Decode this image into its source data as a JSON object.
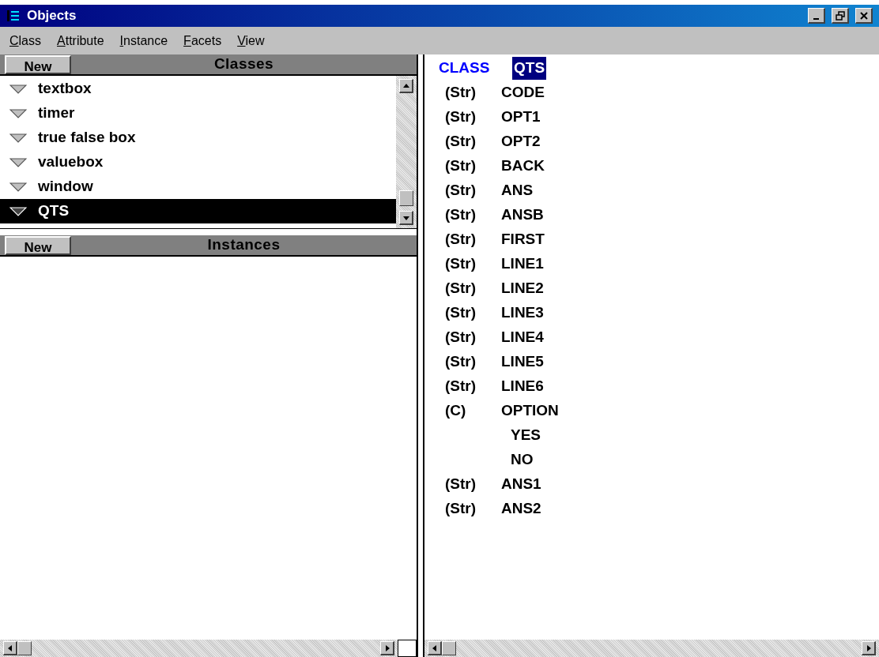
{
  "window": {
    "title": "Objects"
  },
  "menu": [
    "Class",
    "Attribute",
    "Instance",
    "Facets",
    "View"
  ],
  "classes_panel": {
    "new_button": "New",
    "title": "Classes",
    "items": [
      {
        "label": "textbox",
        "selected": false
      },
      {
        "label": "timer",
        "selected": false
      },
      {
        "label": "true false box",
        "selected": false
      },
      {
        "label": "valuebox",
        "selected": false
      },
      {
        "label": "window",
        "selected": false
      },
      {
        "label": "QTS",
        "selected": true
      }
    ]
  },
  "instances_panel": {
    "new_button": "New",
    "title": "Instances"
  },
  "detail": {
    "class_label": "CLASS",
    "class_name": "QTS",
    "attributes": [
      {
        "type": "(Str)",
        "name": "CODE"
      },
      {
        "type": "(Str)",
        "name": "OPT1"
      },
      {
        "type": "(Str)",
        "name": "OPT2"
      },
      {
        "type": "(Str)",
        "name": "BACK"
      },
      {
        "type": "(Str)",
        "name": "ANS"
      },
      {
        "type": "(Str)",
        "name": "ANSB"
      },
      {
        "type": "(Str)",
        "name": "FIRST"
      },
      {
        "type": "(Str)",
        "name": "LINE1"
      },
      {
        "type": "(Str)",
        "name": "LINE2"
      },
      {
        "type": "(Str)",
        "name": "LINE3"
      },
      {
        "type": "(Str)",
        "name": "LINE4"
      },
      {
        "type": "(Str)",
        "name": "LINE5"
      },
      {
        "type": "(Str)",
        "name": "LINE6"
      },
      {
        "type": "(C)",
        "name": "OPTION",
        "children": [
          {
            "name": "YES"
          },
          {
            "name": "NO"
          }
        ]
      },
      {
        "type": "(Str)",
        "name": "ANS1"
      },
      {
        "type": "(Str)",
        "name": "ANS2"
      }
    ]
  }
}
